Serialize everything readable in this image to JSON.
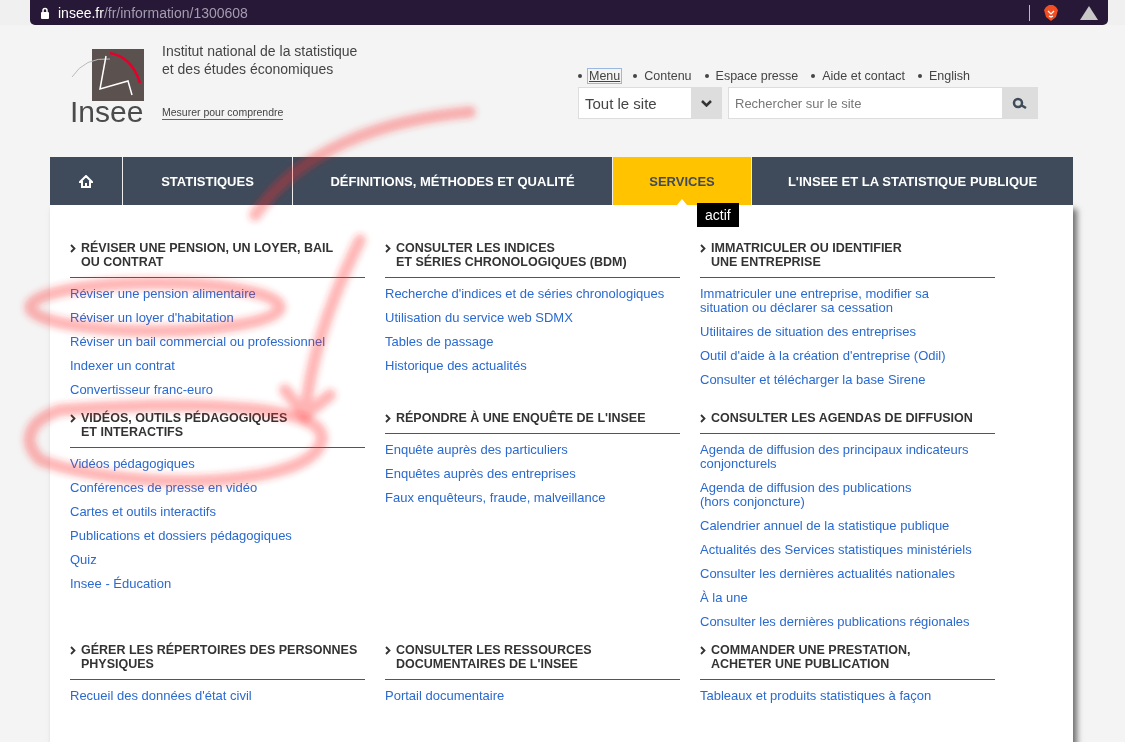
{
  "browser": {
    "url_host": "insee.fr",
    "url_path": "/fr/information/1300608"
  },
  "header": {
    "logo_text": "Insee",
    "org_name": "Institut national de la statistique\net des études économiques",
    "tagline": "Mesurer pour comprendre",
    "top_links": [
      {
        "label": "Menu",
        "focused": true
      },
      {
        "label": "Contenu",
        "focused": false
      },
      {
        "label": "Espace presse",
        "focused": false
      },
      {
        "label": "Aide et contact",
        "focused": false
      },
      {
        "label": "English",
        "focused": false
      }
    ],
    "scope_select": {
      "value": "Tout le site"
    },
    "search": {
      "placeholder": "Rechercher sur le site"
    }
  },
  "nav": [
    {
      "kind": "home",
      "selected": false
    },
    {
      "kind": "text",
      "label": "STATISTIQUES",
      "selected": false
    },
    {
      "kind": "text",
      "label": "DÉFINITIONS, MÉTHODES ET QUALITÉ",
      "selected": false
    },
    {
      "kind": "text",
      "label": "SERVICES",
      "selected": true
    },
    {
      "kind": "text",
      "label": "L'INSEE ET LA STATISTIQUE PUBLIQUE",
      "selected": false
    }
  ],
  "tooltip": "actif",
  "markup_overlay": true,
  "sections": [
    {
      "heading": "RÉVISER UNE PENSION, UN LOYER, BAIL\nOU CONTRAT",
      "links": [
        "Réviser une pension alimentaire",
        "Réviser un loyer d'habitation",
        "Réviser un bail commercial ou professionnel",
        "Indexer un contrat",
        "Convertisseur franc-euro"
      ]
    },
    {
      "heading": "CONSULTER LES INDICES\nET SÉRIES CHRONOLOGIQUES (BDM)",
      "links": [
        "Recherche d'indices et de séries chronologiques",
        "Utilisation du service web SDMX",
        "Tables de passage",
        "Historique des actualités"
      ]
    },
    {
      "heading": "IMMATRICULER OU IDENTIFIER\nUNE ENTREPRISE",
      "links": [
        "Immatriculer une entreprise, modifier sa\nsituation ou déclarer sa cessation",
        "Utilitaires de situation des entreprises",
        "Outil d'aide à la création d'entreprise (Odil)",
        "Consulter et télécharger la base Sirene"
      ]
    },
    {
      "heading": "VIDÉOS, OUTILS PÉDAGOGIQUES\nET INTERACTIFS",
      "links": [
        "Vidéos pédagogiques",
        "Conférences de presse en vidéo",
        "Cartes et outils interactifs",
        "Publications et dossiers pédagogiques",
        "Quiz",
        "Insee - Éducation"
      ]
    },
    {
      "heading": "RÉPONDRE À UNE ENQUÊTE DE L'INSEE",
      "links": [
        "Enquête auprès des particuliers",
        "Enquêtes auprès des entreprises",
        "Faux enquêteurs, fraude, malveillance"
      ]
    },
    {
      "heading": "CONSULTER LES AGENDAS DE DIFFUSION",
      "links": [
        "Agenda de diffusion des principaux indicateurs\nconjoncturels",
        "Agenda de diffusion des publications\n(hors conjoncture)",
        "Calendrier annuel de la statistique publique",
        "Actualités des Services statistiques ministériels",
        "Consulter les dernières actualités nationales",
        "À la une",
        "Consulter les dernières publications régionales"
      ]
    },
    {
      "heading": "GÉRER LES RÉPERTOIRES DES PERSONNES\nPHYSIQUES",
      "links": [
        "Recueil des données d'état civil"
      ]
    },
    {
      "heading": "CONSULTER LES RESSOURCES\nDOCUMENTAIRES DE L'INSEE",
      "links": [
        "Portail documentaire"
      ]
    },
    {
      "heading": "COMMANDER UNE PRESTATION,\nACHETER UNE PUBLICATION",
      "links": [
        "Tableaux et produits statistiques à façon"
      ]
    }
  ]
}
